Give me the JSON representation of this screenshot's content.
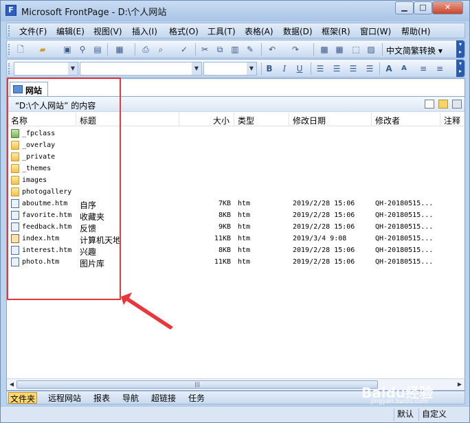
{
  "window": {
    "title": "Microsoft FrontPage - D:\\个人网站",
    "min_glyph": "▁",
    "max_glyph": "□",
    "close_glyph": "✕"
  },
  "menu": [
    "文件(F)",
    "编辑(E)",
    "视图(V)",
    "插入(I)",
    "格式(O)",
    "工具(T)",
    "表格(A)",
    "数据(D)",
    "框架(R)",
    "窗口(W)",
    "帮助(H)"
  ],
  "toolbar": {
    "language_label": "中文简繁转换 ▾"
  },
  "folder_view": {
    "tab_label": "网站",
    "path_label": "“D:\\个人网站” 的内容",
    "columns": {
      "name": "名称",
      "title": "标题",
      "size": "大小",
      "type": "类型",
      "modified": "修改日期",
      "modified_by": "修改者",
      "comments": "注释"
    },
    "items": [
      {
        "name": "_fpclass",
        "title": "",
        "size": "",
        "type": "",
        "modified": "",
        "modified_by": "",
        "icon": "folder-green-icon"
      },
      {
        "name": "_overlay",
        "title": "",
        "size": "",
        "type": "",
        "modified": "",
        "modified_by": "",
        "icon": "folder-icon"
      },
      {
        "name": "_private",
        "title": "",
        "size": "",
        "type": "",
        "modified": "",
        "modified_by": "",
        "icon": "folder-icon"
      },
      {
        "name": "_themes",
        "title": "",
        "size": "",
        "type": "",
        "modified": "",
        "modified_by": "",
        "icon": "folder-icon"
      },
      {
        "name": "images",
        "title": "",
        "size": "",
        "type": "",
        "modified": "",
        "modified_by": "",
        "icon": "folder-icon"
      },
      {
        "name": "photogallery",
        "title": "",
        "size": "",
        "type": "",
        "modified": "",
        "modified_by": "",
        "icon": "folder-icon"
      },
      {
        "name": "aboutme.htm",
        "title": "自序",
        "size": "7KB",
        "type": "htm",
        "modified": "2019/2/28 15:06",
        "modified_by": "QH-20180515...",
        "icon": "page-icon"
      },
      {
        "name": "favorite.htm",
        "title": "收藏夹",
        "size": "8KB",
        "type": "htm",
        "modified": "2019/2/28 15:06",
        "modified_by": "QH-20180515...",
        "icon": "page-icon"
      },
      {
        "name": "feedback.htm",
        "title": "反馈",
        "size": "9KB",
        "type": "htm",
        "modified": "2019/2/28 15:06",
        "modified_by": "QH-20180515...",
        "icon": "page-icon"
      },
      {
        "name": "index.htm",
        "title": "计算机天地",
        "size": "11KB",
        "type": "htm",
        "modified": "2019/3/4 9:08",
        "modified_by": "QH-20180515...",
        "icon": "home-page-icon"
      },
      {
        "name": "interest.htm",
        "title": "兴趣",
        "size": "8KB",
        "type": "htm",
        "modified": "2019/2/28 15:06",
        "modified_by": "QH-20180515...",
        "icon": "page-icon"
      },
      {
        "name": "photo.htm",
        "title": "图片库",
        "size": "11KB",
        "type": "htm",
        "modified": "2019/2/28 15:06",
        "modified_by": "QH-20180515...",
        "icon": "page-icon"
      }
    ],
    "scroll_glyph": "|||"
  },
  "views": [
    "文件夹",
    "远程网站",
    "报表",
    "导航",
    "超链接",
    "任务"
  ],
  "status": {
    "default": "默认",
    "custom": "自定义"
  },
  "watermark": "Baidu经验",
  "watermark_sub": "jingyan.baidu.com",
  "colors": {
    "highlight": "#e8363a",
    "window_frame": "#bcd3ee"
  }
}
